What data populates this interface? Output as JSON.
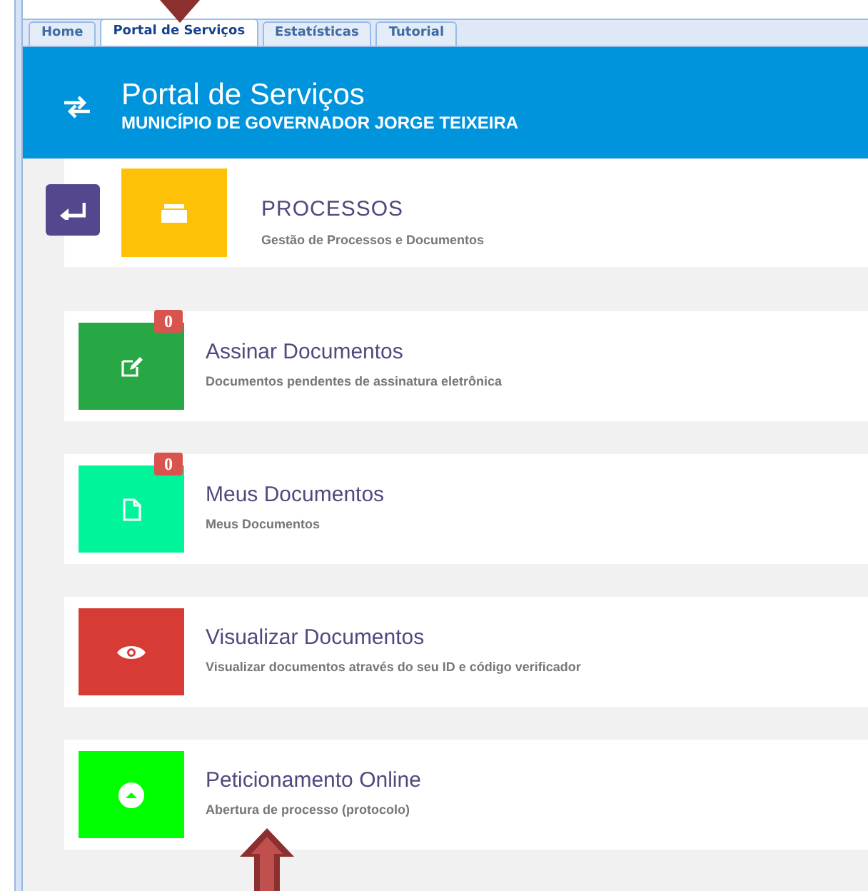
{
  "tabs": [
    {
      "label": "Home",
      "selected": false
    },
    {
      "label": "Portal de Serviços",
      "selected": true
    },
    {
      "label": "Estatísticas",
      "selected": false
    },
    {
      "label": "Tutorial",
      "selected": false
    }
  ],
  "header": {
    "title": "Portal de Serviços",
    "subtitle": "MUNICÍPIO DE GOVERNADOR JORGE TEIXEIRA"
  },
  "section": {
    "title": "PROCESSOS",
    "subtitle": "Gestão de Processos e Documentos",
    "color": "#ffc107"
  },
  "services": [
    {
      "title": "Assinar Documentos",
      "description": "Documentos pendentes de assinatura eletrônica",
      "color": "#28a745",
      "badge": "0"
    },
    {
      "title": "Meus Documentos",
      "description": "Meus Documentos",
      "color": "#00f59b",
      "badge": "0"
    },
    {
      "title": "Visualizar Documentos",
      "description": "Visualizar documentos através do seu ID e código verificador",
      "color": "#d63c35"
    },
    {
      "title": "Peticionamento Online",
      "description": "Abertura de processo (protocolo)",
      "color": "#00ff00"
    }
  ]
}
